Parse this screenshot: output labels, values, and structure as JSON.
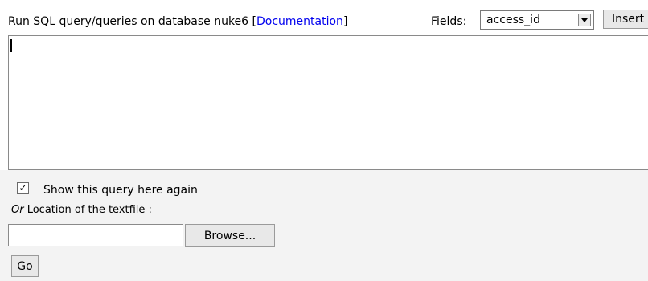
{
  "header": {
    "label_prefix": "Run SQL query/queries on database nuke6 [",
    "doc_link": "Documentation",
    "label_suffix": "]",
    "fields_label": "Fields:",
    "fields_selected": "access_id",
    "insert_label": "Insert"
  },
  "query": {
    "value": ""
  },
  "options": {
    "checkbox_mark": "✓",
    "show_again_label": "Show this query here again",
    "or_word": "Or",
    "location_label": " Location of the textfile :"
  },
  "upload": {
    "file_value": "",
    "browse_label": "Browse..."
  },
  "submit": {
    "go_label": "Go"
  },
  "colors": {
    "link": "#0000ee",
    "lower_background": "#f3f3f3"
  },
  "icons": {
    "dropdown": "chevron-down-icon",
    "checkbox": "checkmark-icon"
  }
}
